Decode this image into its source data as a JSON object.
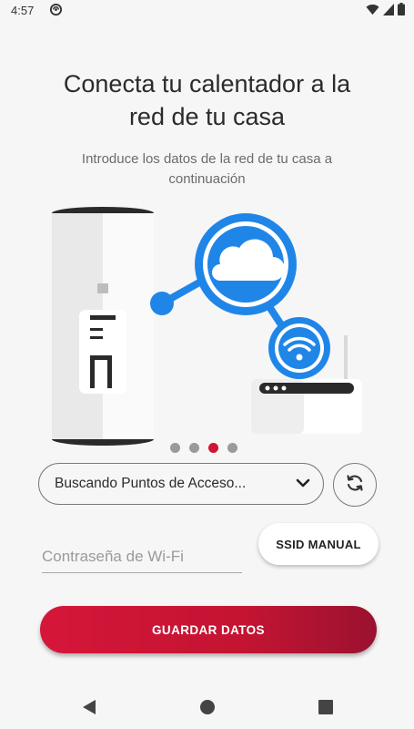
{
  "status_bar": {
    "time": "4:57",
    "icons": [
      "sync-icon",
      "wifi-icon",
      "signal-icon",
      "battery-icon"
    ]
  },
  "header": {
    "title_line1": "Conecta tu calentador a la",
    "title_line2": "red de tu casa",
    "subtitle_line1": "Introduce los datos de la red de tu casa a",
    "subtitle_line2": "continuación"
  },
  "pager": {
    "count": 4,
    "active_index": 2
  },
  "form": {
    "network_select_label": "Buscando Puntos de Acceso...",
    "password_placeholder": "Contraseña de Wi-Fi",
    "ssid_manual_label": "SSID MANUAL",
    "save_label": "GUARDAR DATOS"
  },
  "colors": {
    "accent": "#d21433",
    "illustration_blue": "#1f86e8"
  },
  "nav": [
    "back-icon",
    "home-icon",
    "recents-icon"
  ]
}
